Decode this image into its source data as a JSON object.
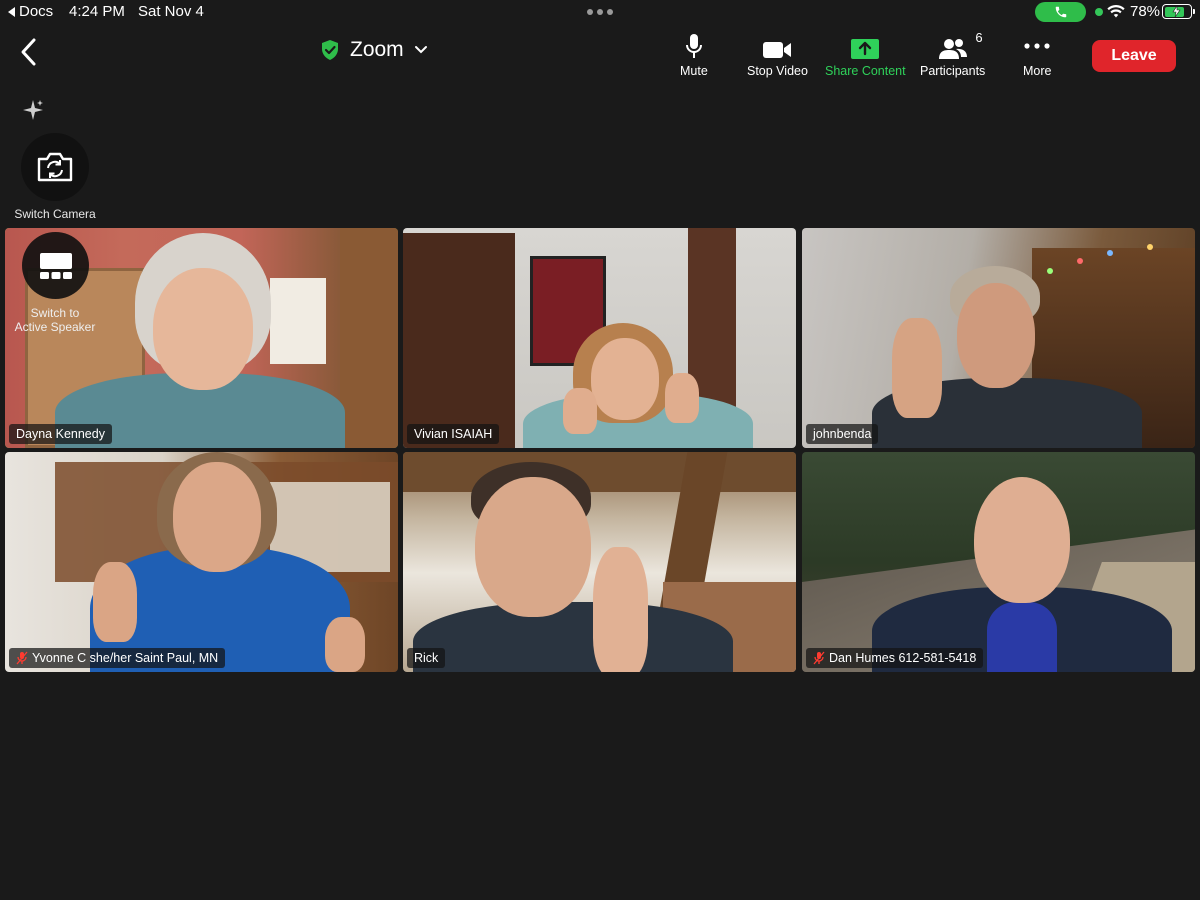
{
  "status_bar": {
    "back_app": "Docs",
    "time": "4:24 PM",
    "date": "Sat Nov 4",
    "battery": "78%",
    "battery_level": 0.78
  },
  "toolbar": {
    "title": "Zoom",
    "mute": "Mute",
    "stop_video": "Stop Video",
    "share_content": "Share Content",
    "participants": "Participants",
    "participant_count": "6",
    "more": "More",
    "leave": "Leave"
  },
  "controls": {
    "switch_camera": "Switch Camera",
    "switch_active_speaker_line1": "Switch to",
    "switch_active_speaker_line2": "Active Speaker"
  },
  "participants": [
    {
      "name": "Dayna Kennedy",
      "muted": false,
      "active": true
    },
    {
      "name": "Vivian ISAIAH",
      "muted": false,
      "active": false
    },
    {
      "name": "johnbenda",
      "muted": false,
      "active": false
    },
    {
      "name": "Yvonne  C  she/her Saint Paul, MN",
      "muted": true,
      "active": false
    },
    {
      "name": "Rick",
      "muted": false,
      "active": false
    },
    {
      "name": "Dan Humes 612-581-5418",
      "muted": true,
      "active": false
    }
  ],
  "colors": {
    "background": "#1a1a1a",
    "accent_green": "#2fd15a",
    "leave_red": "#e0252b",
    "active_border": "#35c659"
  }
}
